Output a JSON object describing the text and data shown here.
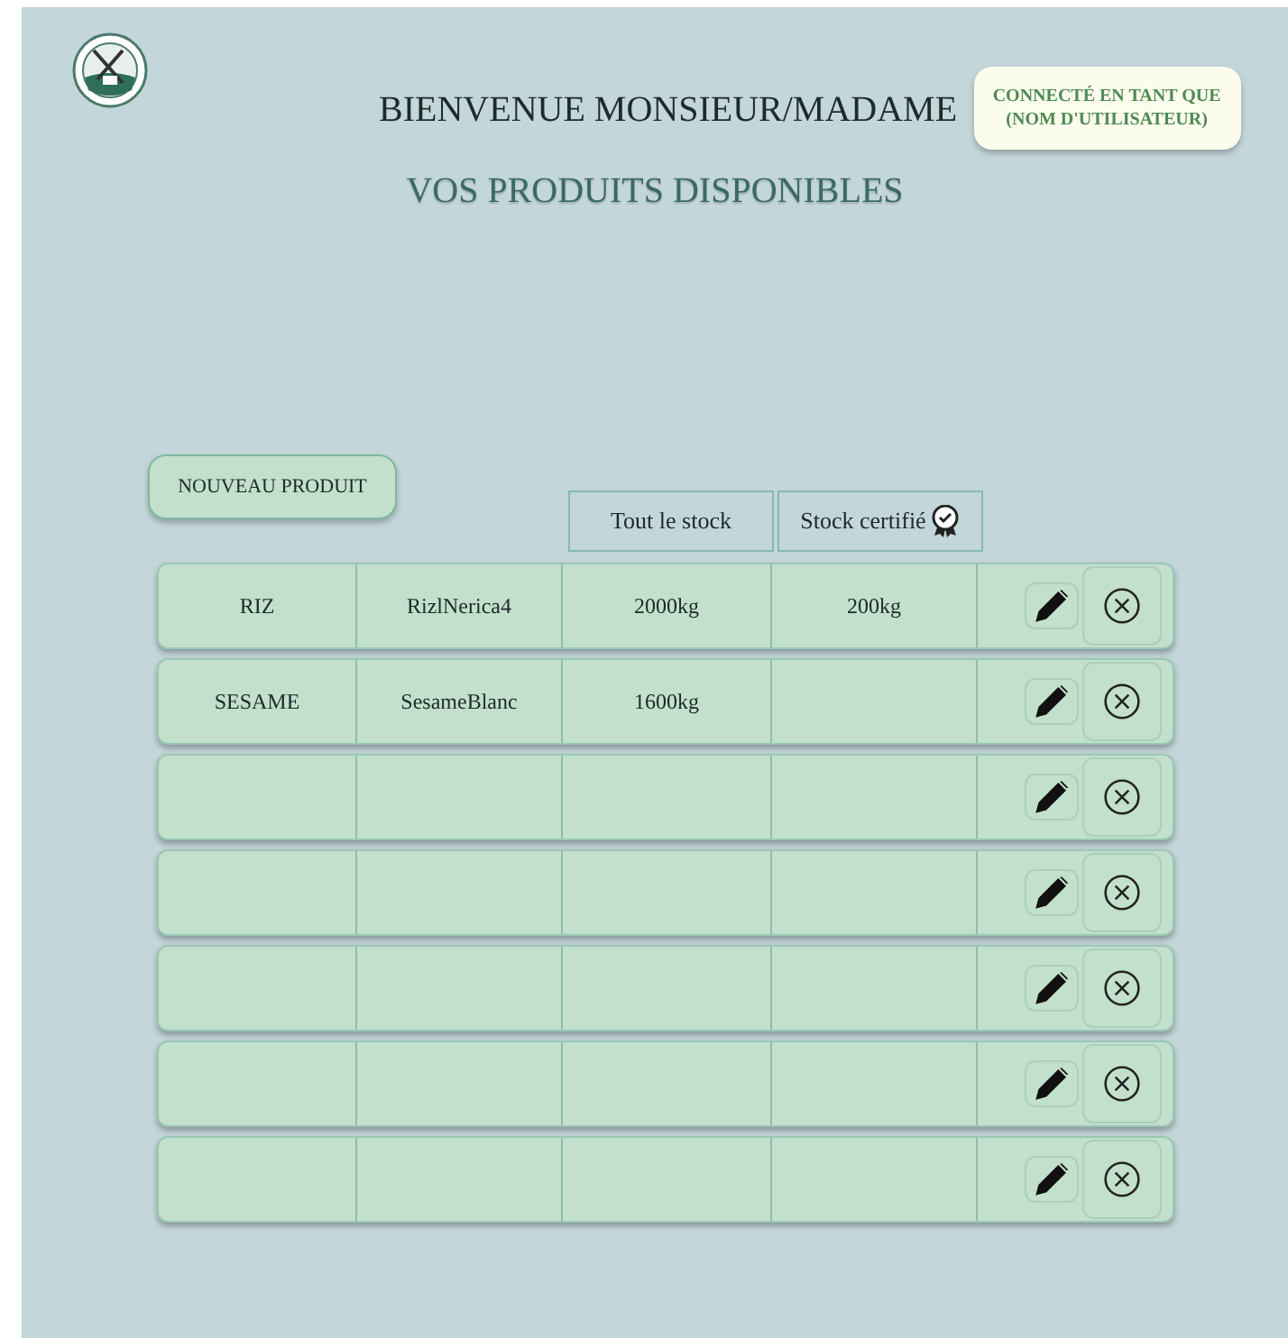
{
  "header": {
    "title": "BIENVENUE MONSIEUR/MADAME",
    "user_badge": [
      "CONNECTÉ EN TANT QUE",
      "(NOM D'UTILISATEUR)"
    ],
    "subtitle": "VOS PRODUITS DISPONIBLES"
  },
  "new_product_button": "NOUVEAU PRODUIT",
  "table": {
    "columns": [
      {},
      {},
      {
        "label": "Tout le stock",
        "certified_icon": false
      },
      {
        "label": "Stock certifié",
        "certified_icon": true
      }
    ],
    "rows": [
      {
        "cells": [
          "RIZ",
          "RizlNerica4",
          "2000kg",
          "200kg"
        ]
      },
      {
        "cells": [
          "SESAME",
          "SesameBlanc",
          "1600kg",
          ""
        ]
      },
      {
        "cells": [
          "",
          "",
          "",
          ""
        ]
      },
      {
        "cells": [
          "",
          "",
          "",
          ""
        ]
      },
      {
        "cells": [
          "",
          "",
          "",
          ""
        ]
      },
      {
        "cells": [
          "",
          "",
          "",
          ""
        ]
      },
      {
        "cells": [
          "",
          "",
          "",
          ""
        ]
      }
    ]
  }
}
